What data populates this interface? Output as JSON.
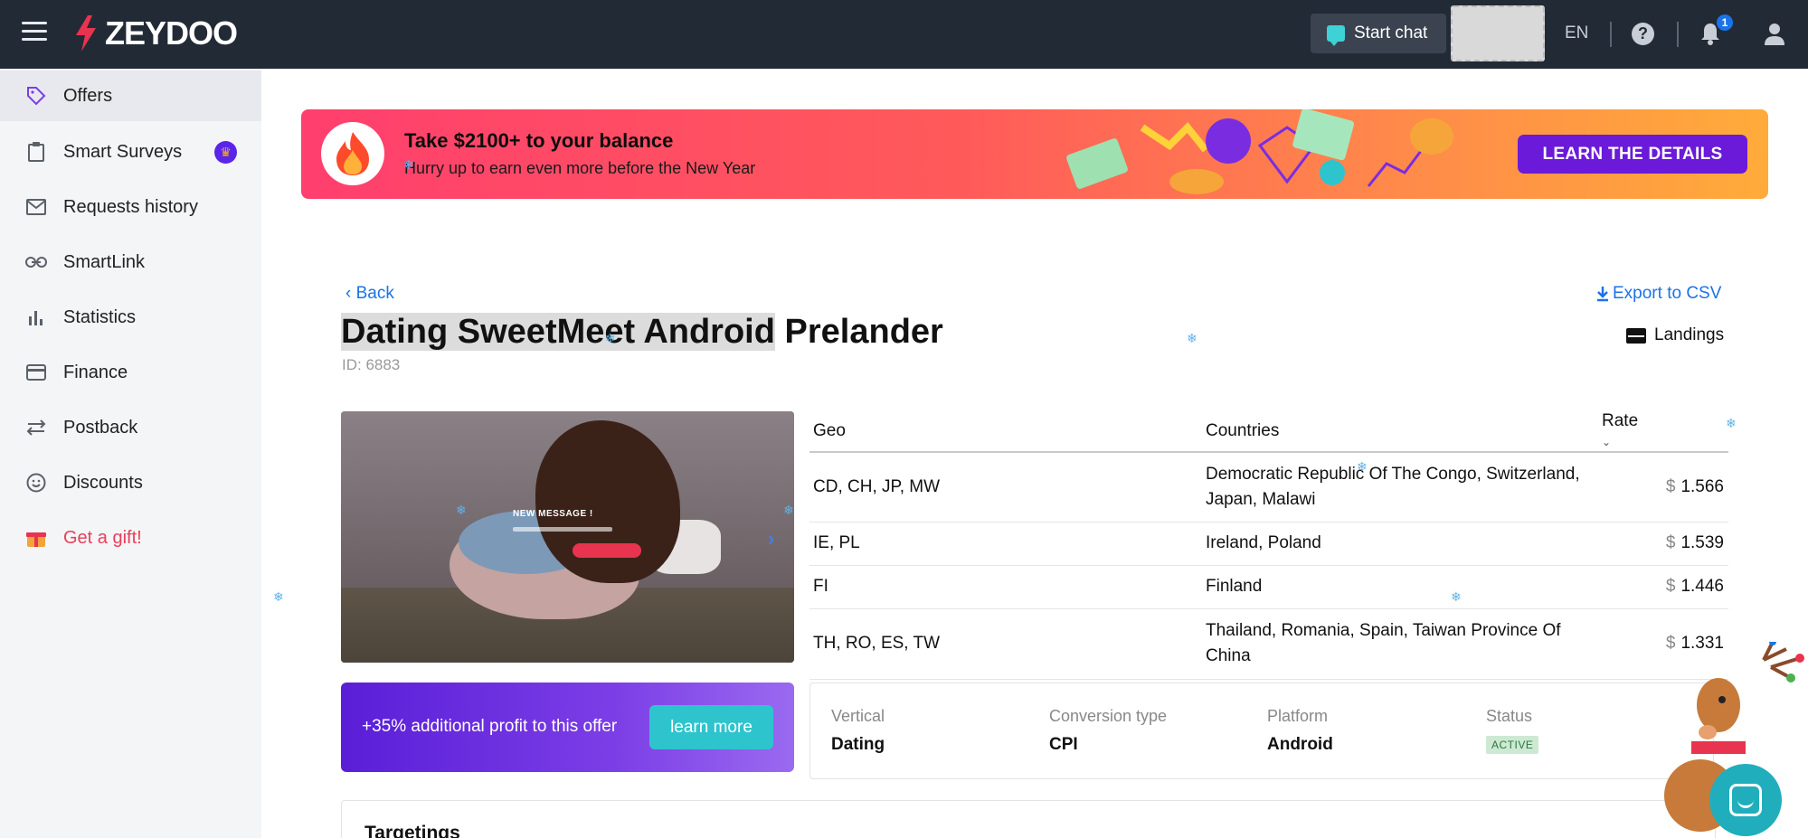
{
  "topbar": {
    "logo_text": "ZEYDOO",
    "start_chat_label": "Start chat",
    "language": "EN",
    "help_glyph": "?",
    "notifications_count": "1"
  },
  "sidebar": {
    "items": [
      {
        "label": "Offers",
        "icon": "tag-icon"
      },
      {
        "label": "Smart Surveys",
        "icon": "clipboard-icon"
      },
      {
        "label": "Requests history",
        "icon": "mail-icon"
      },
      {
        "label": "SmartLink",
        "icon": "link-icon"
      },
      {
        "label": "Statistics",
        "icon": "bar-chart-icon"
      },
      {
        "label": "Finance",
        "icon": "card-icon"
      },
      {
        "label": "Postback",
        "icon": "swap-icon"
      },
      {
        "label": "Discounts",
        "icon": "smile-icon"
      },
      {
        "label": "Get a gift!",
        "icon": "gift-icon"
      }
    ]
  },
  "banner": {
    "title": "Take $2100+ to your balance",
    "subtitle": "Hurry up to earn even more before the New Year",
    "cta": "LEARN THE DETAILS"
  },
  "offer": {
    "back_label": "Back",
    "export_label": "Export to CSV",
    "title_highlighted": "Dating SweetMeet Android",
    "title_rest": " Prelander",
    "id_text": "ID: 6883",
    "landings_label": "Landings",
    "preview_message": "NEW MESSAGE !"
  },
  "rates_table": {
    "headers": {
      "geo": "Geo",
      "countries": "Countries",
      "rate": "Rate"
    },
    "currency": "$",
    "rows": [
      {
        "geo": "CD, CH, JP, MW",
        "countries": "Democratic Republic Of The Congo, Switzerland, Japan, Malawi",
        "rate": "1.566"
      },
      {
        "geo": "IE, PL",
        "countries": "Ireland, Poland",
        "rate": "1.539"
      },
      {
        "geo": "FI",
        "countries": "Finland",
        "rate": "1.446"
      },
      {
        "geo": "TH, RO, ES, TW",
        "countries": "Thailand, Romania, Spain, Taiwan Province Of China",
        "rate": "1.331"
      }
    ]
  },
  "promo": {
    "text": "+35% additional profit to this offer",
    "button": "learn more"
  },
  "info": {
    "vertical_label": "Vertical",
    "vertical_value": "Dating",
    "conversion_label": "Conversion type",
    "conversion_value": "CPI",
    "platform_label": "Platform",
    "platform_value": "Android",
    "status_label": "Status",
    "status_value": "ACTIVE"
  },
  "targetings": {
    "title": "Targetings"
  },
  "colors": {
    "topbar_bg": "#222a35",
    "accent_link": "#1a73e8",
    "cta_purple": "#6a1ad8",
    "teal": "#2ec4cd",
    "gift_red": "#e83e5b"
  }
}
